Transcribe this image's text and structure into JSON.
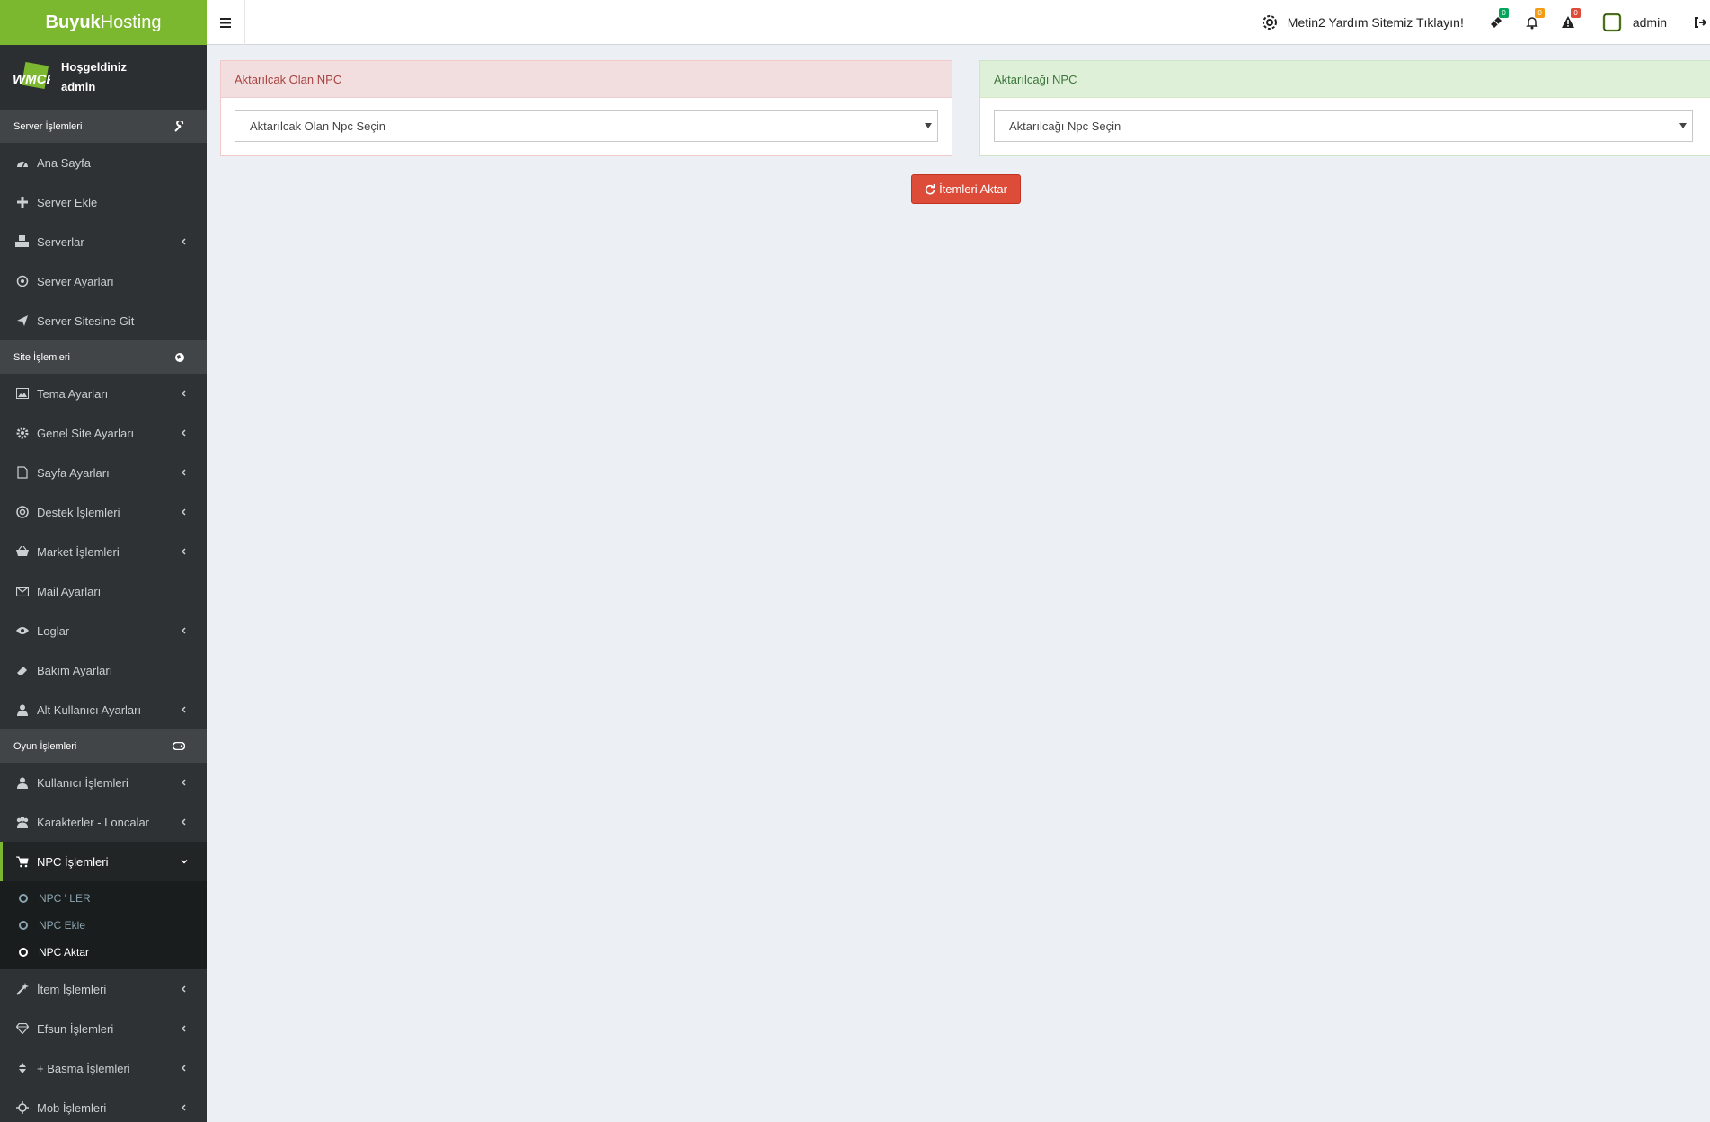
{
  "brand": {
    "bold": "Buyuk",
    "light": "Hosting"
  },
  "header": {
    "help_text": "Metin2 Yardım Sitemiz Tıklayın!",
    "badges": {
      "tickets": "0",
      "notifications": "0",
      "alerts": "0"
    },
    "user_name": "admin"
  },
  "user_panel": {
    "greeting": "Hoşgeldiniz",
    "name": "admin"
  },
  "sidebar": {
    "server_header": "Server İşlemleri",
    "server_items": [
      "Ana Sayfa",
      "Server Ekle",
      "Serverlar",
      "Server Ayarları",
      "Server Sitesine Git"
    ],
    "site_header": "Site İşlemleri",
    "site_items": [
      "Tema Ayarları",
      "Genel Site Ayarları",
      "Sayfa Ayarları",
      "Destek İşlemleri",
      "Market İşlemleri",
      "Mail Ayarları",
      "Loglar",
      "Bakım Ayarları",
      "Alt Kullanıcı Ayarları"
    ],
    "game_header": "Oyun İşlemleri",
    "game_items": [
      "Kullanıcı İşlemleri",
      "Karakterler - Loncalar",
      "NPC İşlemleri"
    ],
    "npc_sub": [
      "NPC ' LER",
      "NPC Ekle",
      "NPC Aktar"
    ],
    "more_items": [
      "İtem İşlemleri",
      "Efsun İşlemleri",
      "+ Basma İşlemleri",
      "Mob İşlemleri"
    ]
  },
  "content": {
    "left_title": "Aktarılcak Olan NPC",
    "left_select": "Aktarılcak Olan Npc Seçin",
    "right_title": "Aktarılcağı NPC",
    "right_select": "Aktarılcağı Npc Seçin",
    "button": "İtemleri Aktar"
  },
  "colors": {
    "brand": "#7cb82f",
    "danger": "#dd4b39",
    "sidebar": "#2f3234"
  }
}
